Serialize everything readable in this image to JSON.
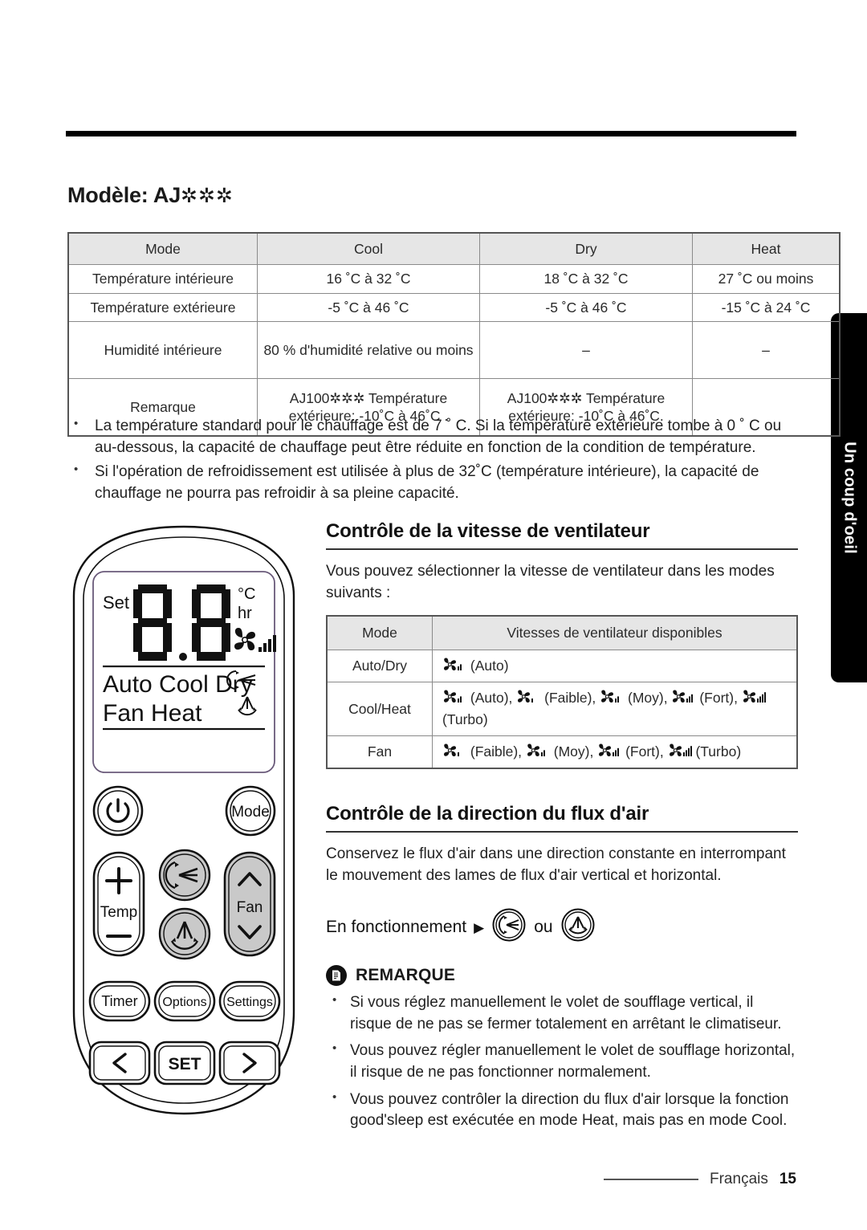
{
  "page": {
    "model_heading": "Modèle: AJ",
    "model_asterisks": "✲✲✲",
    "side_tab": "Un coup d'oeil",
    "footer_language": "Français",
    "footer_page": "15"
  },
  "spec_table": {
    "headers": [
      "Mode",
      "Cool",
      "Dry",
      "Heat"
    ],
    "rows": [
      [
        "Température intérieure",
        "16 ˚C à 32 ˚C",
        "18 ˚C à 32 ˚C",
        "27 ˚C ou moins"
      ],
      [
        "Température extérieure",
        "-5 ˚C à 46 ˚C",
        "-5 ˚C à 46 ˚C",
        "-15 ˚C à 24 ˚C"
      ],
      [
        "Humidité intérieure",
        "80 % d'humidité relative ou moins",
        "–",
        "–"
      ],
      [
        "Remarque",
        "AJ100✲✲✲ Température extérieure: -10˚C à 46˚C .",
        "AJ100✲✲✲ Température extérieure: -10˚C à 46˚C.",
        ""
      ]
    ]
  },
  "spec_notes": [
    "La température standard pour le chauffage est de 7 ˚ C. Si la température extérieure tombe à 0 ˚ C ou au-dessous, la capacité de chauffage peut être réduite en fonction de la condition de température.",
    "Si l'opération de refroidissement est utilisée à plus de 32˚C (température intérieure), la capacité de chauffage ne pourra pas refroidir à sa pleine capacité."
  ],
  "fan_section": {
    "title": "Contrôle de la vitesse de ventilateur",
    "intro": "Vous pouvez sélectionner la vitesse de ventilateur dans les modes suivants :",
    "headers": [
      "Mode",
      "Vitesses de ventilateur disponibles"
    ],
    "rows": [
      {
        "mode": "Auto/Dry",
        "speeds": [
          {
            "level": 2,
            "label": "(Auto)"
          }
        ]
      },
      {
        "mode": "Cool/Heat",
        "speeds": [
          {
            "level": 2,
            "label": "(Auto),"
          },
          {
            "level": 1,
            "label": "(Faible),"
          },
          {
            "level": 2,
            "label": "(Moy),"
          },
          {
            "level": 3,
            "label": "(Fort),"
          },
          {
            "level": 4,
            "label": "(Turbo)"
          }
        ]
      },
      {
        "mode": "Fan",
        "speeds": [
          {
            "level": 1,
            "label": "(Faible),"
          },
          {
            "level": 2,
            "label": "(Moy),"
          },
          {
            "level": 3,
            "label": "(Fort),"
          },
          {
            "level": 4,
            "label": "(Turbo)"
          }
        ]
      }
    ]
  },
  "airflow_section": {
    "title": "Contrôle de la direction du flux d'air",
    "intro": "Conservez le flux d'air dans une direction constante en interrompant le mouvement des lames de flux d'air vertical et horizontal.",
    "operation_label": "En fonctionnement",
    "or_label": "ou",
    "note_title": "REMARQUE",
    "notes": [
      "Si vous réglez manuellement le volet de soufflage vertical, il risque de ne pas se fermer totalement en arrêtant le climatiseur.",
      "Vous pouvez régler manuellement le volet de soufflage horizontal, il risque de ne pas fonctionner normalement.",
      "Vous pouvez contrôler la direction du flux d'air lorsque la fonction good'sleep est exécutée en mode Heat, mais pas en mode Cool."
    ]
  },
  "remote": {
    "display": {
      "set_label": "Set",
      "digits": "88",
      "unit_c": "°C",
      "unit_hr": "hr",
      "modes_row1": [
        "Auto",
        "Cool",
        "Dry"
      ],
      "modes_row2": [
        "Fan",
        "Heat"
      ]
    },
    "buttons": {
      "power": "power-icon",
      "mode": "Mode",
      "temp": "Temp",
      "temp_up": "+",
      "temp_down": "−",
      "fan": "Fan",
      "timer": "Timer",
      "options": "Options",
      "settings": "Settings",
      "set": "SET",
      "prev": "‹",
      "next": "›"
    }
  },
  "colors": {
    "header_fill": "#e6e6e6",
    "border": "#8a8a8a",
    "tab_bg": "#000000",
    "button_gray": "#c9c9c9"
  }
}
